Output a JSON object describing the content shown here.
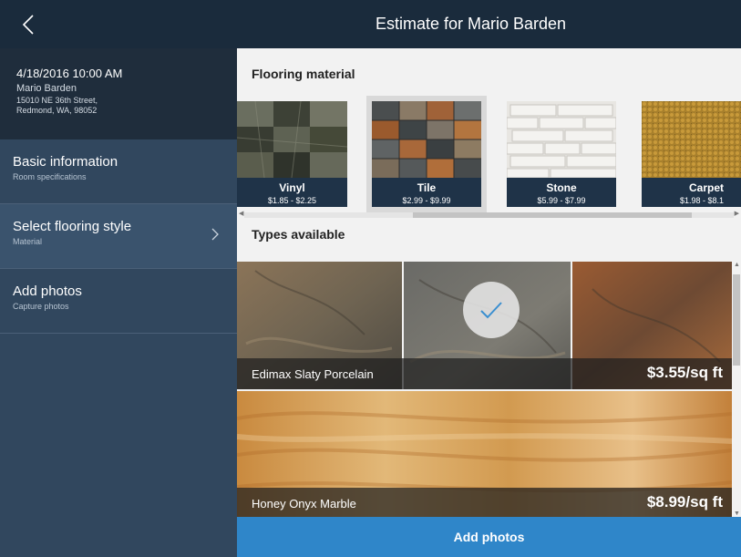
{
  "header": {
    "title": "Estimate for Mario Barden",
    "back_icon": "chevron-left-icon",
    "background": "#1a2b3c"
  },
  "customer": {
    "datetime": "4/18/2016 10:00 AM",
    "name": "Mario Barden",
    "address_line1": "15010 NE 36th Street,",
    "address_line2": "Redmond, WA, 98052"
  },
  "sidebar": {
    "items": [
      {
        "label": "Basic information",
        "sub": "Room specifications"
      },
      {
        "label": "Select flooring style",
        "sub": "Material",
        "icon": "chevron-right-icon"
      },
      {
        "label": "Add photos",
        "sub": "Capture photos"
      }
    ]
  },
  "main": {
    "flooring_title": "Flooring material",
    "types_title": "Types available",
    "materials": [
      {
        "name": "Vinyl",
        "price": "$1.85 - $2.25"
      },
      {
        "name": "Tile",
        "price": "$2.99 - $9.99",
        "selected": true
      },
      {
        "name": "Stone",
        "price": "$5.99 - $7.99"
      },
      {
        "name": "Carpet",
        "price": "$1.98 - $8.1"
      }
    ],
    "types": [
      {
        "name": "Edimax Slaty Porcelain",
        "price": "$3.55/sq ft",
        "selected": true
      },
      {
        "name": "Honey Onyx Marble",
        "price": "$8.99/sq ft"
      }
    ]
  },
  "footer": {
    "button_label": "Add photos",
    "accent": "#2f86c9"
  }
}
